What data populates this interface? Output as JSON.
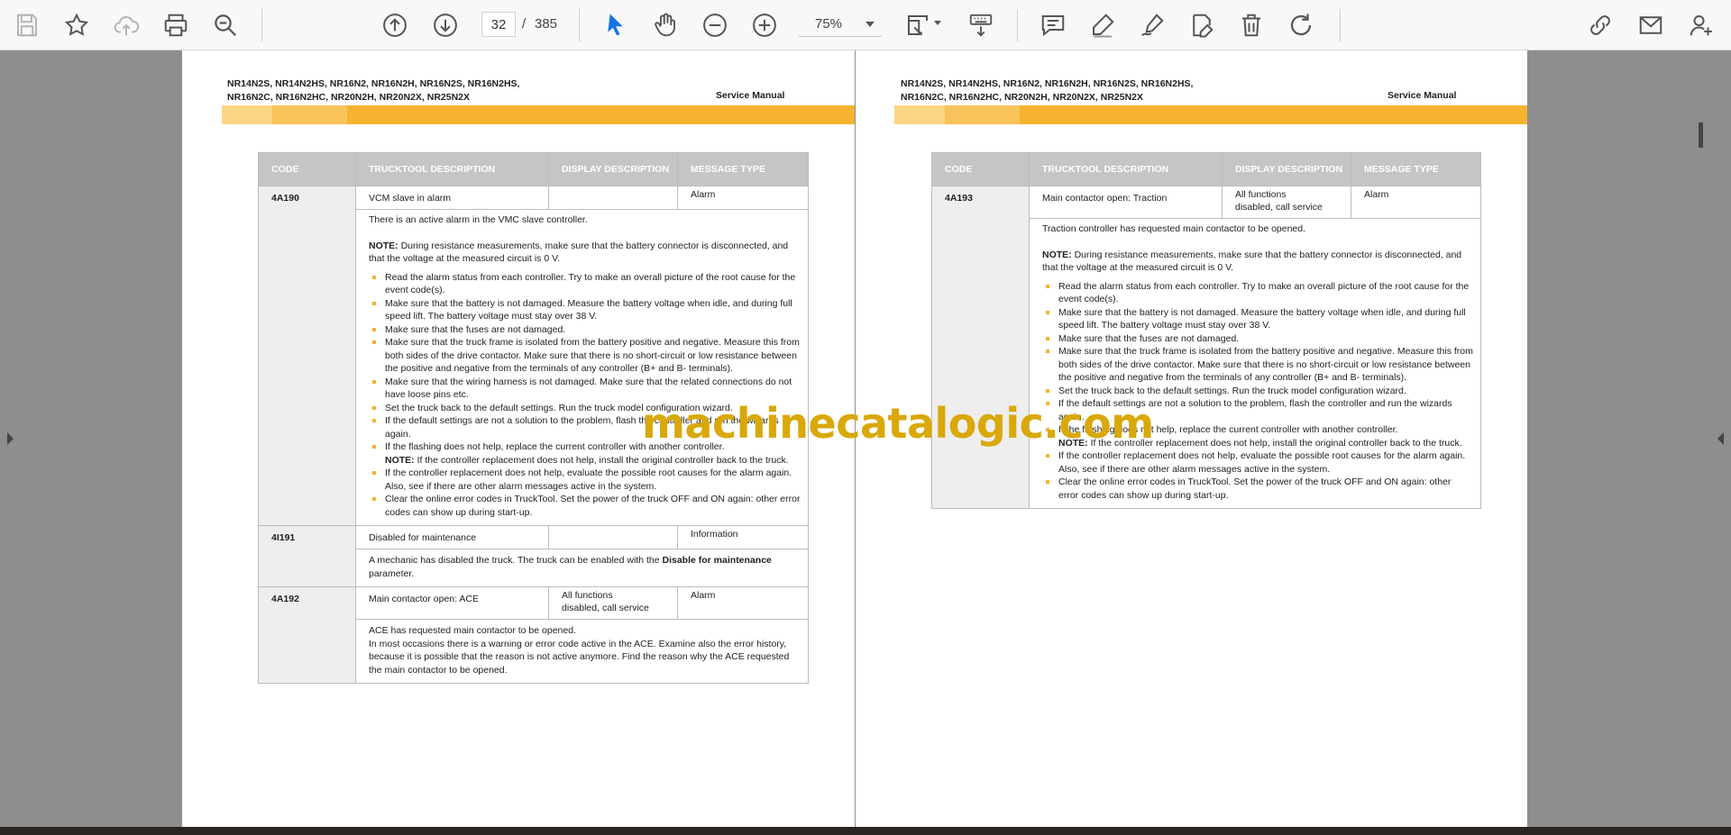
{
  "toolbar": {
    "icons": [
      "save-icon",
      "bookmark-star-icon",
      "cloud-upload-icon",
      "print-icon",
      "zoom-search-icon",
      "page-up-icon",
      "page-down-icon",
      "select-cursor-icon",
      "hand-tool-icon",
      "zoom-out-icon",
      "zoom-in-icon",
      "fit-page-icon",
      "keyboard-icon",
      "comment-icon",
      "highlight-pen-icon",
      "sign-icon",
      "edit-pdf-icon",
      "delete-icon",
      "rotate-icon",
      "share-link-icon",
      "email-icon",
      "account-icon"
    ],
    "current_page": "32",
    "page_separator": "/",
    "total_pages": "385",
    "zoom": "75%",
    "accent_color": "#1473e6"
  },
  "left_page": {
    "models_line1": "NR14N2S, NR14N2HS, NR16N2, NR16N2H, NR16N2S, NR16N2HS,",
    "models_line2": "NR16N2C, NR16N2HC, NR20N2H, NR20N2X, NR25N2X",
    "service_manual": "Service Manual",
    "headers": {
      "code": "CODE",
      "trucktool": "TRUCKTOOL DESCRIPTION",
      "display": "DISPLAY DESCRIPTION",
      "message": "MESSAGE TYPE"
    },
    "rows": [
      {
        "code": "4A190",
        "trucktool": "VCM slave in alarm",
        "display": "",
        "message": "Alarm",
        "text": "There is an active alarm in the VMC slave controller.",
        "note_label": "NOTE:",
        "note": " During resistance measurements, make sure that the battery connector is disconnected, and that the voltage at the measured circuit is 0 V.",
        "bullets": [
          "Read the alarm status from each controller. Try to make an overall picture of the root cause for the event code(s).",
          "Make sure that the battery is not damaged. Measure the battery voltage when idle, and during full speed lift. The battery voltage must stay over 38 V.",
          "Make sure that the fuses are not damaged.",
          "Make sure that the truck frame is isolated from the battery positive and negative. Measure this from both sides of the drive contactor. Make sure that there is no short-circuit or low resistance between the positive and negative from the terminals of any controller (B+ and B- terminals).",
          "Make sure that the wiring harness is not damaged. Make sure that the related connections do not have loose pins etc.",
          "Set the truck back to the default settings. Run the truck model configuration wizard.",
          "If the default settings are not a solution to the problem, flash the controller and run the wizards again.",
          "If the flashing does not help, replace the current controller with another controller.",
          "If the controller replacement does not help, evaluate the possible root causes for the alarm again. Also, see if there are other alarm messages active in the system.",
          "Clear the online error codes in TruckTool. Set the power of the truck OFF and ON again: other error codes can show up during start-up."
        ],
        "inline_note_label": "NOTE:",
        "inline_note": " If the controller replacement does not help, install the original controller back to the truck."
      },
      {
        "code": "4I191",
        "trucktool": "Disabled for maintenance",
        "display": "",
        "message": "Information",
        "text_pre": "A mechanic has disabled the truck. The truck can be enabled with the ",
        "text_bold": "Disable for maintenance",
        "text_post": " parameter."
      },
      {
        "code": "4A192",
        "trucktool": "Main contactor open: ACE",
        "display_line1": "All functions",
        "display_line2": "disabled, call service",
        "message": "Alarm",
        "text1": "ACE has requested main contactor to be opened.",
        "text2": "In most occasions there is a warning or error code active in the ACE. Examine also the error history, because it is possible that the reason is not active anymore. Find the reason why the ACE requested the main contactor to be opened."
      }
    ]
  },
  "right_page": {
    "models_line1": "NR14N2S, NR14N2HS, NR16N2, NR16N2H, NR16N2S, NR16N2HS,",
    "models_line2": "NR16N2C, NR16N2HC, NR20N2H, NR20N2X, NR25N2X",
    "service_manual": "Service Manual",
    "headers": {
      "code": "CODE",
      "trucktool": "TRUCKTOOL DESCRIPTION",
      "display": "DISPLAY DESCRIPTION",
      "message": "MESSAGE TYPE"
    },
    "row": {
      "code": "4A193",
      "trucktool": "Main contactor open: Traction",
      "display_line1": "All functions",
      "display_line2": "disabled, call service",
      "message": "Alarm",
      "text": "Traction controller has requested main contactor to be opened.",
      "note_label": "NOTE:",
      "note": " During resistance measurements, make sure that the battery connector is disconnected, and that the voltage at the measured circuit is 0 V.",
      "bullets": [
        "Read the alarm status from each controller. Try to make an overall picture of the root cause for the event code(s).",
        "Make sure that the battery is not damaged. Measure the battery voltage when idle, and during full speed lift. The battery voltage must stay over 38 V.",
        "Make sure that the fuses are not damaged.",
        "Make sure that the truck frame is isolated from the battery positive and negative. Measure this from both sides of the drive contactor. Make sure that there is no short-circuit or low resistance between the positive and negative from the terminals of any controller (B+ and B- terminals).",
        "Set the truck back to the default settings. Run the truck model configuration wizard.",
        "If the default settings are not a solution to the problem, flash the controller and run the wizards again.",
        "If the flashing does not help, replace the current controller with another controller.",
        "If the controller replacement does not help, evaluate the possible root causes for the alarm again. Also, see if there are other alarm messages active in the system.",
        "Clear the online error codes in TruckTool. Set the power of the truck OFF and ON again: other error codes can show up during start-up."
      ],
      "inline_note_label": "NOTE:",
      "inline_note": " If the controller replacement does not help, install the original controller back to the truck."
    }
  },
  "watermark": "machinecatalogic.com"
}
